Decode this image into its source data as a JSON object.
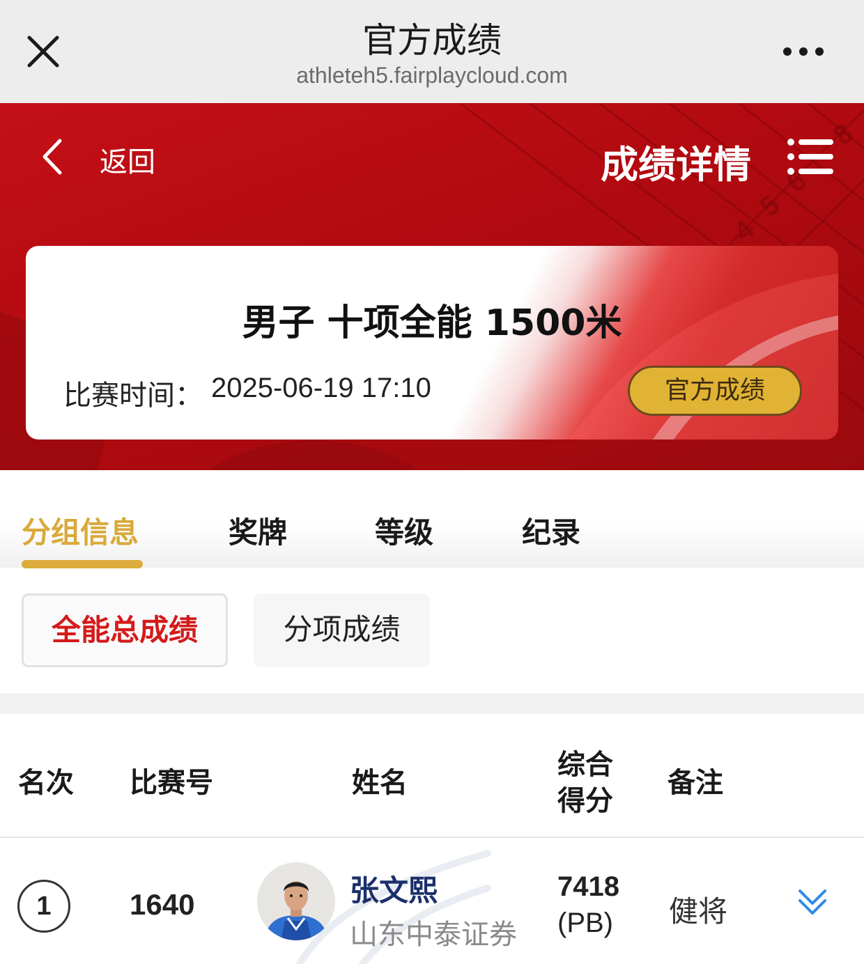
{
  "topbar": {
    "title": "官方成绩",
    "url": "athleteh5.fairplaycloud.com",
    "close_icon": "close-icon",
    "more_icon": "more-dots-icon"
  },
  "header": {
    "back_label": "返回",
    "title": "成绩详情",
    "back_icon": "chevron-left-icon",
    "menu_icon": "list-menu-icon",
    "decor_digits": [
      "4",
      "5",
      "6",
      "8"
    ]
  },
  "event": {
    "name": "男子 十项全能 1500米",
    "time_label": "比赛时间：",
    "time_value": "2025-06-19  17:10",
    "badge": "官方成绩"
  },
  "tabs": [
    {
      "label": "分组信息",
      "active": true
    },
    {
      "label": "奖牌",
      "active": false
    },
    {
      "label": "等级",
      "active": false
    },
    {
      "label": "纪录",
      "active": false
    }
  ],
  "subtabs": [
    {
      "label": "全能总成绩",
      "active": true
    },
    {
      "label": "分项成绩",
      "active": false
    }
  ],
  "table": {
    "headers": {
      "rank": "名次",
      "bib": "比赛号",
      "name": "姓名",
      "score_line1": "综合",
      "score_line2": "得分",
      "remark": "备注"
    },
    "rows": [
      {
        "rank": "1",
        "bib": "1640",
        "name": "张文熙",
        "team": "山东中泰证券",
        "score": "7418",
        "score_note": "(PB)",
        "remark": "健将",
        "expand_icon": "double-chevron-down-icon"
      }
    ]
  },
  "colors": {
    "header_red": "#b10a10",
    "gold": "#dcad3c",
    "active_red": "#d41a1a",
    "name_navy": "#1b2f6b",
    "expand_blue": "#2f8be6"
  }
}
